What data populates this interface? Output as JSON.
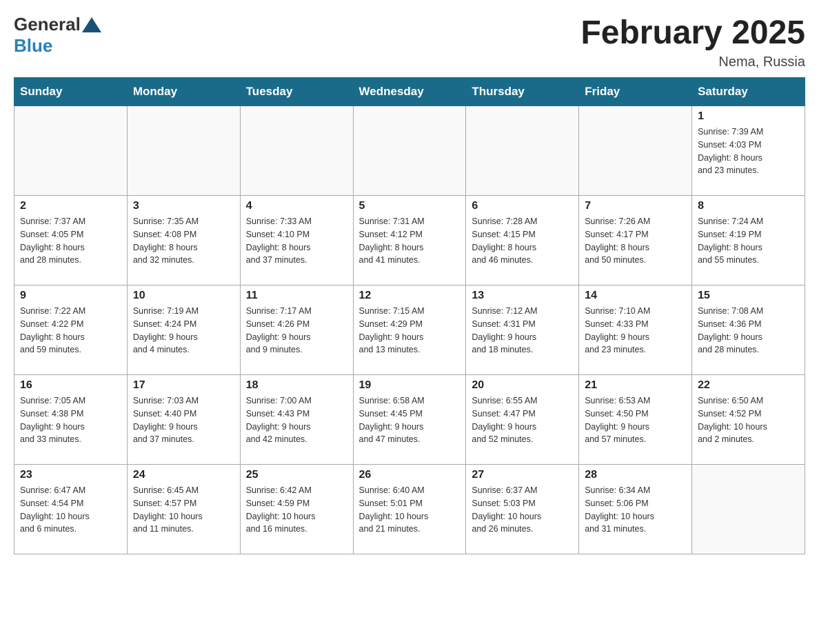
{
  "header": {
    "logo_general": "General",
    "logo_blue": "Blue",
    "month_title": "February 2025",
    "location": "Nema, Russia"
  },
  "days_of_week": [
    "Sunday",
    "Monday",
    "Tuesday",
    "Wednesday",
    "Thursday",
    "Friday",
    "Saturday"
  ],
  "weeks": [
    [
      {
        "day": "",
        "info": ""
      },
      {
        "day": "",
        "info": ""
      },
      {
        "day": "",
        "info": ""
      },
      {
        "day": "",
        "info": ""
      },
      {
        "day": "",
        "info": ""
      },
      {
        "day": "",
        "info": ""
      },
      {
        "day": "1",
        "info": "Sunrise: 7:39 AM\nSunset: 4:03 PM\nDaylight: 8 hours\nand 23 minutes."
      }
    ],
    [
      {
        "day": "2",
        "info": "Sunrise: 7:37 AM\nSunset: 4:05 PM\nDaylight: 8 hours\nand 28 minutes."
      },
      {
        "day": "3",
        "info": "Sunrise: 7:35 AM\nSunset: 4:08 PM\nDaylight: 8 hours\nand 32 minutes."
      },
      {
        "day": "4",
        "info": "Sunrise: 7:33 AM\nSunset: 4:10 PM\nDaylight: 8 hours\nand 37 minutes."
      },
      {
        "day": "5",
        "info": "Sunrise: 7:31 AM\nSunset: 4:12 PM\nDaylight: 8 hours\nand 41 minutes."
      },
      {
        "day": "6",
        "info": "Sunrise: 7:28 AM\nSunset: 4:15 PM\nDaylight: 8 hours\nand 46 minutes."
      },
      {
        "day": "7",
        "info": "Sunrise: 7:26 AM\nSunset: 4:17 PM\nDaylight: 8 hours\nand 50 minutes."
      },
      {
        "day": "8",
        "info": "Sunrise: 7:24 AM\nSunset: 4:19 PM\nDaylight: 8 hours\nand 55 minutes."
      }
    ],
    [
      {
        "day": "9",
        "info": "Sunrise: 7:22 AM\nSunset: 4:22 PM\nDaylight: 8 hours\nand 59 minutes."
      },
      {
        "day": "10",
        "info": "Sunrise: 7:19 AM\nSunset: 4:24 PM\nDaylight: 9 hours\nand 4 minutes."
      },
      {
        "day": "11",
        "info": "Sunrise: 7:17 AM\nSunset: 4:26 PM\nDaylight: 9 hours\nand 9 minutes."
      },
      {
        "day": "12",
        "info": "Sunrise: 7:15 AM\nSunset: 4:29 PM\nDaylight: 9 hours\nand 13 minutes."
      },
      {
        "day": "13",
        "info": "Sunrise: 7:12 AM\nSunset: 4:31 PM\nDaylight: 9 hours\nand 18 minutes."
      },
      {
        "day": "14",
        "info": "Sunrise: 7:10 AM\nSunset: 4:33 PM\nDaylight: 9 hours\nand 23 minutes."
      },
      {
        "day": "15",
        "info": "Sunrise: 7:08 AM\nSunset: 4:36 PM\nDaylight: 9 hours\nand 28 minutes."
      }
    ],
    [
      {
        "day": "16",
        "info": "Sunrise: 7:05 AM\nSunset: 4:38 PM\nDaylight: 9 hours\nand 33 minutes."
      },
      {
        "day": "17",
        "info": "Sunrise: 7:03 AM\nSunset: 4:40 PM\nDaylight: 9 hours\nand 37 minutes."
      },
      {
        "day": "18",
        "info": "Sunrise: 7:00 AM\nSunset: 4:43 PM\nDaylight: 9 hours\nand 42 minutes."
      },
      {
        "day": "19",
        "info": "Sunrise: 6:58 AM\nSunset: 4:45 PM\nDaylight: 9 hours\nand 47 minutes."
      },
      {
        "day": "20",
        "info": "Sunrise: 6:55 AM\nSunset: 4:47 PM\nDaylight: 9 hours\nand 52 minutes."
      },
      {
        "day": "21",
        "info": "Sunrise: 6:53 AM\nSunset: 4:50 PM\nDaylight: 9 hours\nand 57 minutes."
      },
      {
        "day": "22",
        "info": "Sunrise: 6:50 AM\nSunset: 4:52 PM\nDaylight: 10 hours\nand 2 minutes."
      }
    ],
    [
      {
        "day": "23",
        "info": "Sunrise: 6:47 AM\nSunset: 4:54 PM\nDaylight: 10 hours\nand 6 minutes."
      },
      {
        "day": "24",
        "info": "Sunrise: 6:45 AM\nSunset: 4:57 PM\nDaylight: 10 hours\nand 11 minutes."
      },
      {
        "day": "25",
        "info": "Sunrise: 6:42 AM\nSunset: 4:59 PM\nDaylight: 10 hours\nand 16 minutes."
      },
      {
        "day": "26",
        "info": "Sunrise: 6:40 AM\nSunset: 5:01 PM\nDaylight: 10 hours\nand 21 minutes."
      },
      {
        "day": "27",
        "info": "Sunrise: 6:37 AM\nSunset: 5:03 PM\nDaylight: 10 hours\nand 26 minutes."
      },
      {
        "day": "28",
        "info": "Sunrise: 6:34 AM\nSunset: 5:06 PM\nDaylight: 10 hours\nand 31 minutes."
      },
      {
        "day": "",
        "info": ""
      }
    ]
  ]
}
